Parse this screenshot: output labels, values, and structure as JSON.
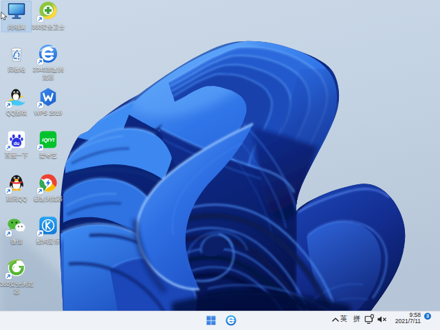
{
  "desktop": {
    "wallpaper_name": "Windows 11 Bloom",
    "selected_icon": "此电脑",
    "icons": [
      {
        "id": "this-pc",
        "label": "此电脑",
        "col": 0,
        "row": 0,
        "selected": true,
        "shortcut": false
      },
      {
        "id": "360-safe",
        "label": "360安全卫士",
        "col": 1,
        "row": 0,
        "selected": false,
        "shortcut": true
      },
      {
        "id": "recycle-bin",
        "label": "回收站",
        "col": 0,
        "row": 1,
        "selected": false,
        "shortcut": false
      },
      {
        "id": "2345-browser",
        "label": "2345加速浏览器",
        "col": 1,
        "row": 1,
        "selected": false,
        "shortcut": true
      },
      {
        "id": "qq-game",
        "label": "QQ游戏",
        "col": 0,
        "row": 2,
        "selected": false,
        "shortcut": true
      },
      {
        "id": "wps-2019",
        "label": "WPS 2019",
        "col": 1,
        "row": 2,
        "selected": false,
        "shortcut": true
      },
      {
        "id": "baidu",
        "label": "百度一下",
        "col": 0,
        "row": 3,
        "selected": false,
        "shortcut": true
      },
      {
        "id": "iqiyi",
        "label": "爱奇艺",
        "col": 1,
        "row": 3,
        "selected": false,
        "shortcut": true
      },
      {
        "id": "tencent-qq",
        "label": "腾讯QQ",
        "col": 0,
        "row": 4,
        "selected": false,
        "shortcut": true
      },
      {
        "id": "speed-browser",
        "label": "极速浏览器",
        "col": 1,
        "row": 4,
        "selected": false,
        "shortcut": true
      },
      {
        "id": "wechat",
        "label": "微信",
        "col": 0,
        "row": 5,
        "selected": false,
        "shortcut": true
      },
      {
        "id": "kugou-music",
        "label": "酷狗音乐",
        "col": 1,
        "row": 5,
        "selected": false,
        "shortcut": true
      },
      {
        "id": "360-browser",
        "label": "360安全浏览器",
        "col": 0,
        "row": 6,
        "selected": false,
        "shortcut": true
      }
    ]
  },
  "taskbar": {
    "buttons": [
      {
        "id": "start",
        "name": "start-button"
      },
      {
        "id": "edge",
        "name": "edge-button"
      }
    ]
  },
  "tray": {
    "ime_primary": "英",
    "ime_secondary": "拼",
    "time": "9:58",
    "date": "2021/7/11",
    "badge_count": "3"
  },
  "icon_art": {
    "baidu_text": "du",
    "iqiyi_text": "iQIYI"
  },
  "colors": {
    "taskbar_bg": "#eff2f7",
    "badge_blue": "#1871c8",
    "bloom_bright": "#2e74e8",
    "bloom_dark": "#0a2070",
    "background_sky": "#c6d4e2"
  }
}
